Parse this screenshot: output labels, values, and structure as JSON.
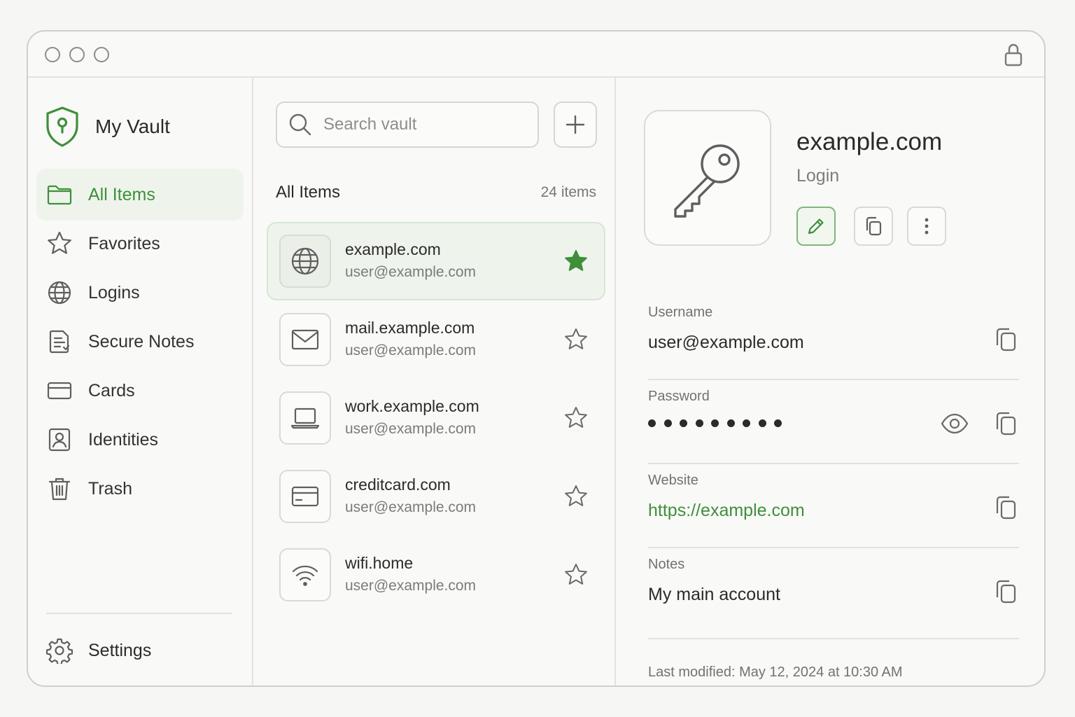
{
  "sidebar": {
    "brand": "My Vault",
    "items": [
      {
        "label": "All Items",
        "icon": "folder-icon"
      },
      {
        "label": "Favorites",
        "icon": "star-icon"
      },
      {
        "label": "Logins",
        "icon": "globe-icon"
      },
      {
        "label": "Secure Notes",
        "icon": "note-icon"
      },
      {
        "label": "Cards",
        "icon": "card-icon"
      },
      {
        "label": "Identities",
        "icon": "identity-icon"
      },
      {
        "label": "Trash",
        "icon": "trash-icon"
      }
    ],
    "settings_label": "Settings"
  },
  "list": {
    "search_placeholder": "Search vault",
    "title": "All Items",
    "count": "24 items",
    "items": [
      {
        "name": "example.com",
        "sub": "user@example.com",
        "icon": "globe-icon",
        "favorite": true
      },
      {
        "name": "mail.example.com",
        "sub": "user@example.com",
        "icon": "mail-icon",
        "favorite": false
      },
      {
        "name": "work.example.com",
        "sub": "user@example.com",
        "icon": "laptop-icon",
        "favorite": false
      },
      {
        "name": "creditcard.com",
        "sub": "user@example.com",
        "icon": "card-icon",
        "favorite": false
      },
      {
        "name": "wifi.home",
        "sub": "user@example.com",
        "icon": "wifi-icon",
        "favorite": false
      }
    ]
  },
  "detail": {
    "title": "example.com",
    "type": "Login",
    "username_label": "Username",
    "username": "user@example.com",
    "password_label": "Password",
    "password_mask_count": 9,
    "website_label": "Website",
    "website": "https://example.com",
    "notes_label": "Notes",
    "notes": "My main account",
    "modified": "Last modified: May 12, 2024 at 10:30 AM"
  },
  "colors": {
    "accent": "#3f8f3a",
    "selected_bg": "#eef4ec",
    "icon_stroke": "#5f5f5f"
  }
}
